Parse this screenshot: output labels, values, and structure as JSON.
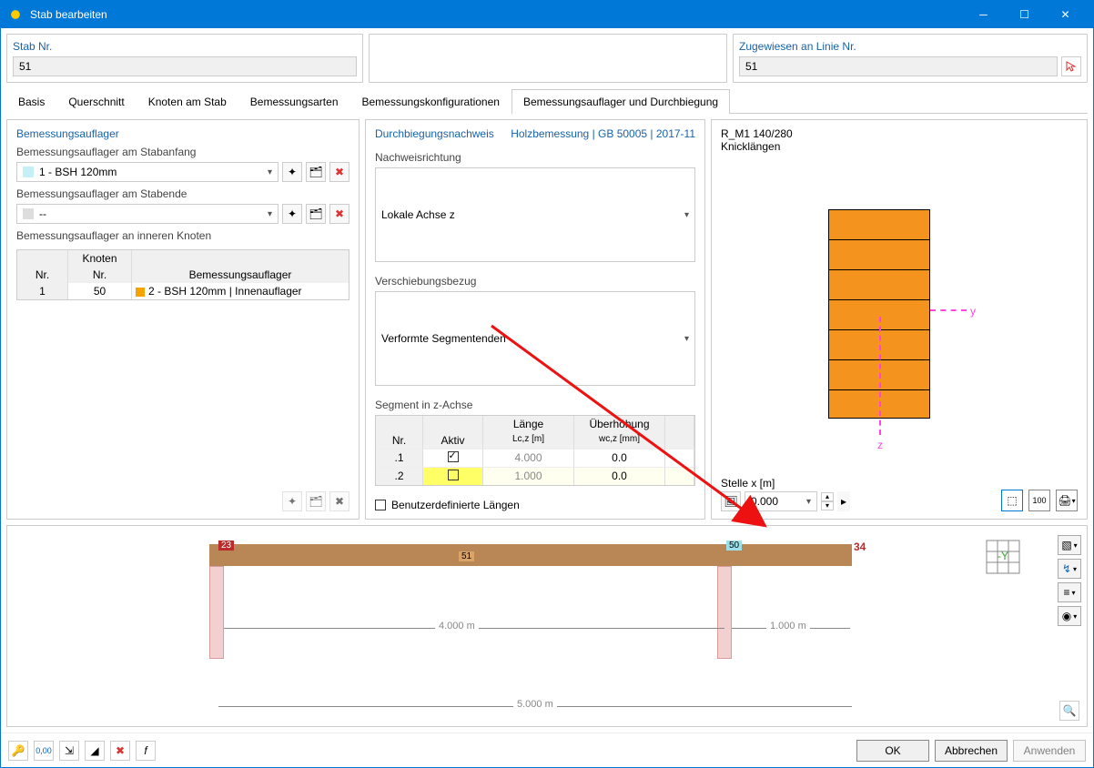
{
  "window": {
    "title": "Stab bearbeiten"
  },
  "header": {
    "stab_nr_label": "Stab Nr.",
    "stab_nr_value": "51",
    "linie_label": "Zugewiesen an Linie Nr.",
    "linie_value": "51"
  },
  "tabs": {
    "t0": "Basis",
    "t1": "Querschnitt",
    "t2": "Knoten am Stab",
    "t3": "Bemessungsarten",
    "t4": "Bemessungskonfigurationen",
    "t5": "Bemessungsauflager und Durchbiegung"
  },
  "left": {
    "heading": "Bemessungsauflager",
    "anfang_label": "Bemessungsauflager am Stabanfang",
    "anfang_value": "1 - BSH   120mm",
    "ende_label": "Bemessungsauflager am Stabende",
    "ende_value": "--",
    "innen_label": "Bemessungsauflager an inneren Knoten",
    "grid": {
      "h_nr": "Nr.",
      "h_knoten": "Knoten",
      "h_knoten2": "Nr.",
      "h_auflager": "Bemessungsauflager",
      "r1_nr": "1",
      "r1_knoten": "50",
      "r1_text": "2 - BSH   120mm | Innenauflager"
    }
  },
  "mid": {
    "heading": "Durchbiegungsnachweis",
    "heading_right": "Holzbemessung | GB 50005 | 2017-11",
    "dir_label": "Nachweisrichtung",
    "dir_value": "Lokale Achse z",
    "ref_label": "Verschiebungsbezug",
    "ref_value": "Verformte Segmentenden",
    "seg_label": "Segment in z-Achse",
    "seg_head": {
      "nr": "Nr.",
      "aktiv": "Aktiv",
      "len_t": "Länge",
      "len_b": "Lc,z [m]",
      "ov_t": "Überhöhung",
      "ov_b": "wc,z [mm]"
    },
    "seg_rows": {
      "r1": {
        "nr": ".1",
        "len": "4.000",
        "ov": "0.0"
      },
      "r2": {
        "nr": ".2",
        "len": "1.000",
        "ov": "0.0"
      }
    },
    "user_len_label": "Benutzerdefinierte Längen"
  },
  "right": {
    "title1": "R_M1 140/280",
    "title2": "Knicklängen",
    "stelle_label": "Stelle x [m]",
    "stelle_value": "0.000",
    "axis_y": "y",
    "axis_z": "z"
  },
  "viewport": {
    "n23": "23",
    "n50": "50",
    "n51": "51",
    "n34": "34",
    "dim1": "4.000 m",
    "dim2": "1.000 m",
    "dimTotal": "5.000 m"
  },
  "footer": {
    "ok": "OK",
    "cancel": "Abbrechen",
    "apply": "Anwenden"
  }
}
